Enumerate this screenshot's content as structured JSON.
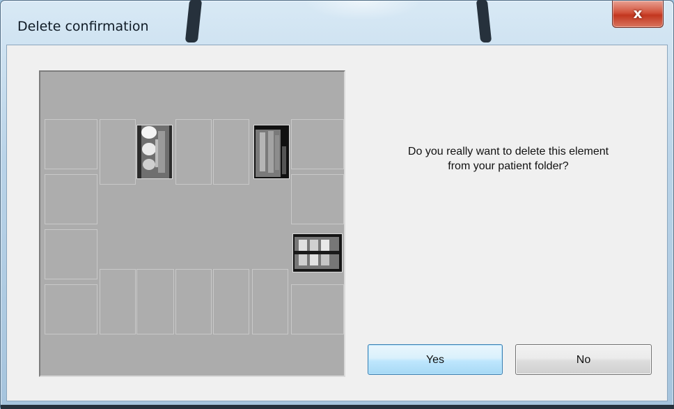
{
  "window": {
    "title": "Delete confirmation",
    "close_glyph": "x"
  },
  "dialog": {
    "message_line1": "Do you really want to delete this element",
    "message_line2": "from your patient folder?",
    "yes_label": "Yes",
    "no_label": "No"
  },
  "preview": {
    "layout": "full-mouth x-ray series",
    "filled_slots": [
      "upper-left-premolar",
      "upper-right-molar",
      "right-bitewing"
    ]
  },
  "colors": {
    "preview_bg": "#acacac",
    "yes_border": "#3c7fb1",
    "close_red": "#c2361f"
  }
}
